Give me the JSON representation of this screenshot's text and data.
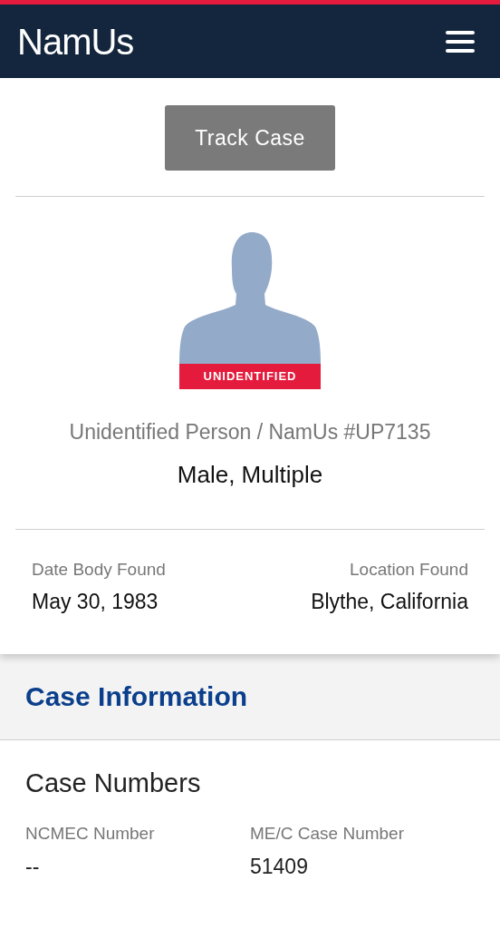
{
  "header": {
    "logo": "NamUs"
  },
  "actions": {
    "track_button": "Track Case"
  },
  "profile": {
    "badge": "UNIDENTIFIED",
    "case_title": "Unidentified Person / NamUs #UP7135",
    "subtitle": "Male, Multiple"
  },
  "details": [
    {
      "label": "Date Body Found",
      "value": "May 30, 1983"
    },
    {
      "label": "Location Found",
      "value": "Blythe, California"
    }
  ],
  "section": {
    "title": "Case Information"
  },
  "case_numbers": {
    "title": "Case Numbers",
    "fields": [
      {
        "label": "NCMEC Number",
        "value": "--"
      },
      {
        "label": "ME/C Case Number",
        "value": "51409"
      }
    ]
  }
}
